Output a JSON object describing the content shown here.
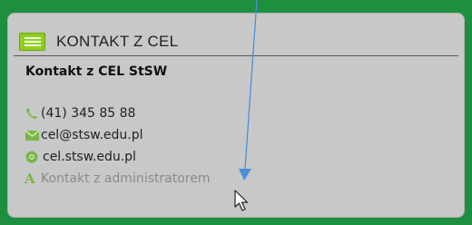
{
  "panel": {
    "title": "KONTAKT Z CEL",
    "org_name": "Kontakt z CEL StSW"
  },
  "contacts": {
    "phone": "(41) 345 85 88",
    "email": "cel@stsw.edu.pl",
    "website": "cel.stsw.edu.pl",
    "admin_link": "Kontakt z administratorem",
    "admin_icon_letter": "A"
  },
  "icons": {
    "header": "list-icon",
    "phone": "phone-icon",
    "email": "envelope-icon",
    "website": "chrome-icon",
    "admin": "font-icon",
    "cursor": "mouse-pointer-icon"
  },
  "colors": {
    "background": "#1e8f3f",
    "card": "#c8c8c8",
    "accent_green": "#7ab648",
    "annotation_arrow": "#4a90d9"
  }
}
